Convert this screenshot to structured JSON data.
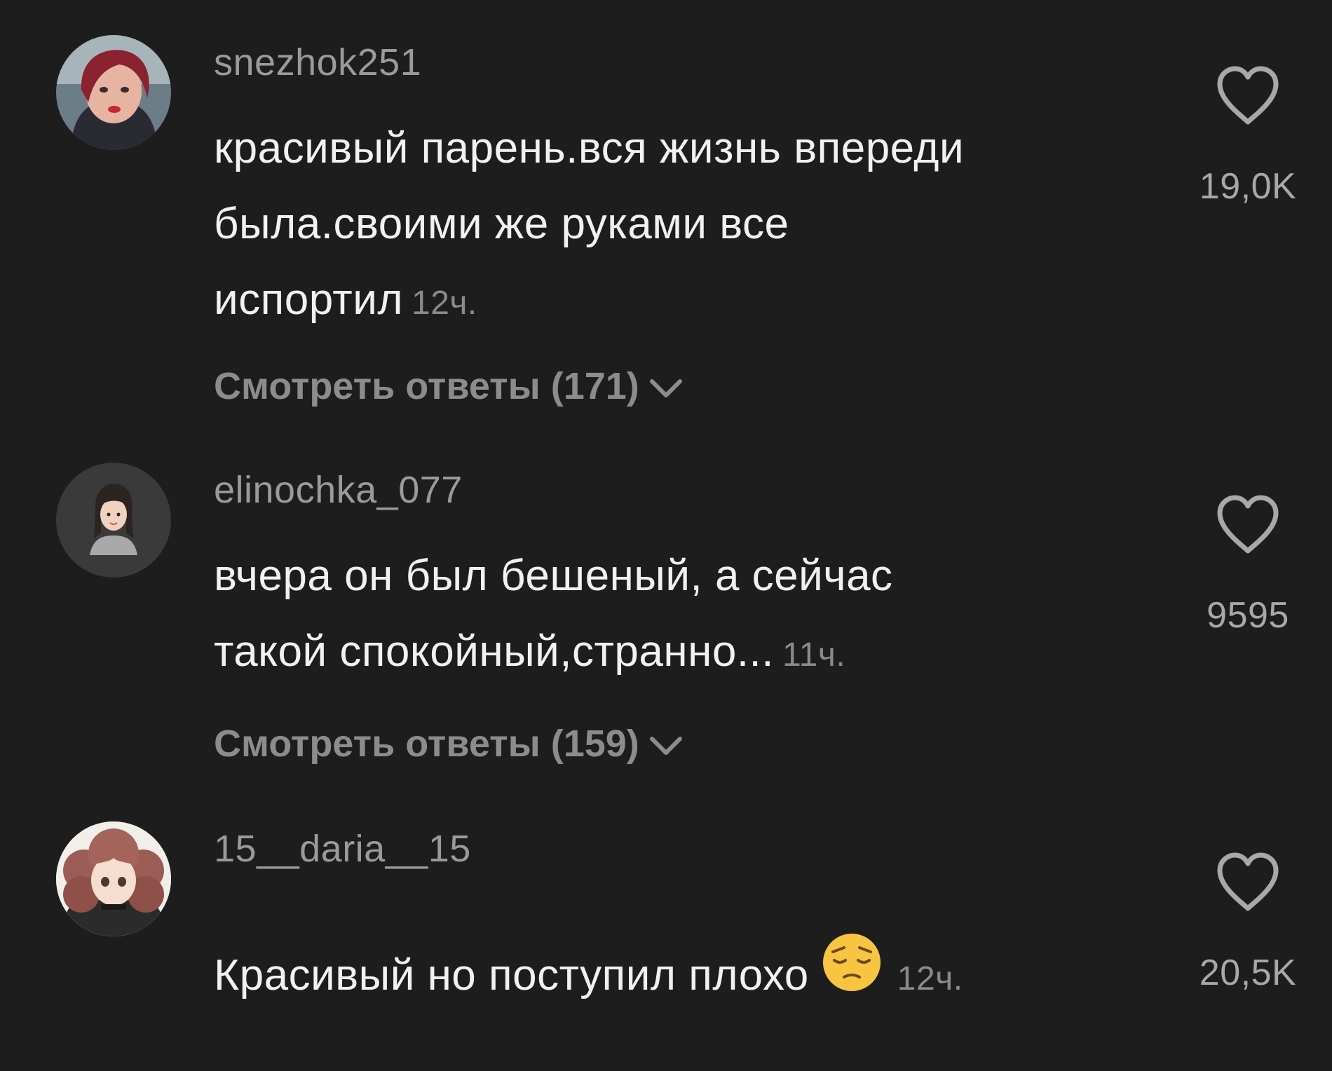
{
  "comments": [
    {
      "username": "snezhok251",
      "lines": [
        "красивый парень.вся жизнь впереди",
        "была.своими же руками все",
        "испортил"
      ],
      "time": "12ч.",
      "replies_label": "Смотреть ответы (171)",
      "likes": "19,0K"
    },
    {
      "username": "elinochka_077",
      "lines": [
        "вчера он был бешеный, а сейчас",
        "такой спокойный,странно..."
      ],
      "time": "11ч.",
      "replies_label": "Смотреть ответы (159)",
      "likes": "9595"
    },
    {
      "username": "15__daria__15",
      "lines": [
        "Красивый но поступил плохо"
      ],
      "emoji": "pensive-face-emoji",
      "time": "12ч.",
      "likes": "20,5K"
    }
  ],
  "colors": {
    "background": "#1d1d1d",
    "text": "#f1f1f1",
    "secondary": "#9a9a9a"
  }
}
